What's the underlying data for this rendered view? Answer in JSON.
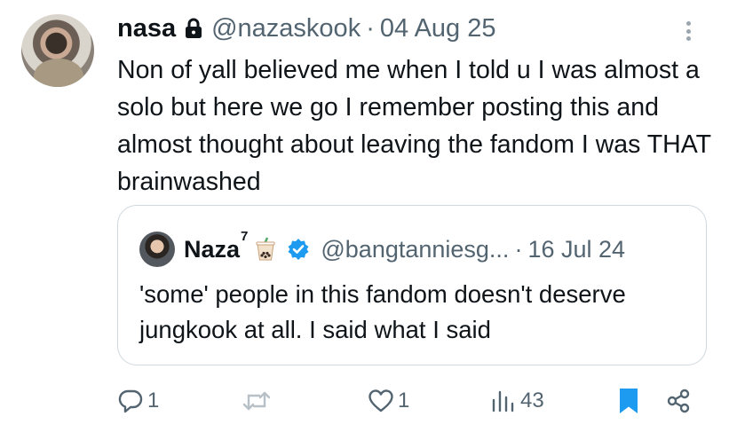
{
  "tweet": {
    "author_name": "nasa",
    "author_handle": "@nazaskook",
    "separator": "·",
    "date": "04 Aug 25",
    "text": "Non of yall believed me when I told u I was almost a solo but here we go I remember posting this and almost thought about leaving the fandom I was THAT brainwashed",
    "author_protected_icon": "lock-icon",
    "more_icon": "more-vertical-icon"
  },
  "quoted_tweet": {
    "author_name": "Naza",
    "name_superscript": "7",
    "emoji_icon": "bubble-tea-icon",
    "verified_icon": "verified-badge-icon",
    "author_handle": "@bangtanniesg...",
    "separator": "·",
    "date": "16 Jul 24",
    "text": "'some' people in this fandom doesn't deserve jungkook at all. I said what I said"
  },
  "actions": {
    "replies": "1",
    "retweets": "",
    "likes": "1",
    "views": "43",
    "icons": [
      "reply-icon",
      "retweet-icon",
      "like-icon",
      "views-icon",
      "bookmark-icon",
      "share-icon"
    ]
  },
  "colors": {
    "text_primary": "#0f1419",
    "text_secondary": "#536471",
    "verified_blue": "#1d9bf0",
    "bookmark_blue": "#1d9bf0",
    "border": "#cfd9de"
  }
}
